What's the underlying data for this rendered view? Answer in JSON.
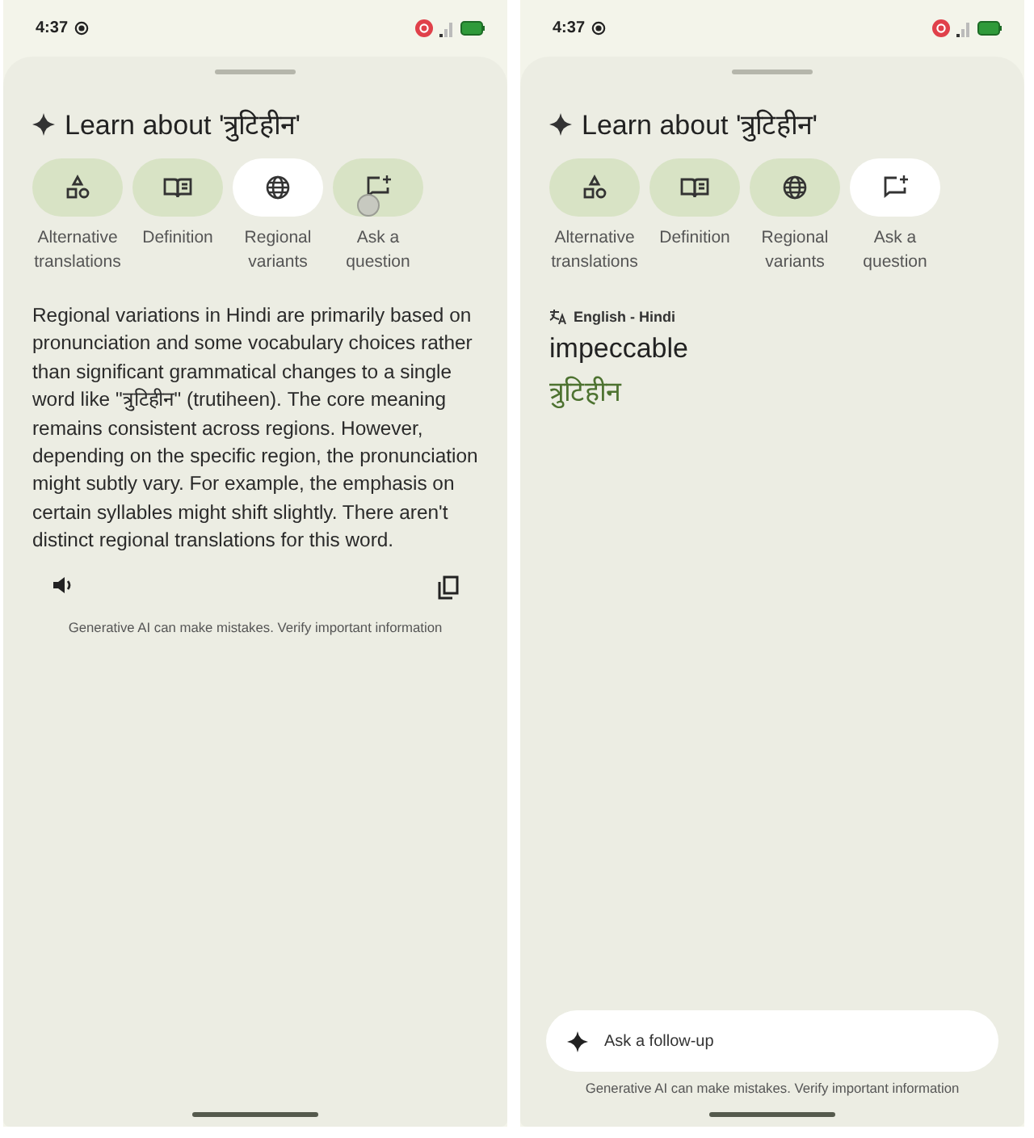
{
  "screens": [
    {
      "kind": "answer",
      "status_bar": {
        "time": "4:37"
      },
      "title": "Learn about 'त्रुटिहीन'",
      "chips": [
        {
          "label": "Alternative translations",
          "selected": false,
          "touched": false
        },
        {
          "label": "Definition",
          "selected": false,
          "touched": false
        },
        {
          "label": "Regional variants",
          "selected": true,
          "touched": false
        },
        {
          "label": "Ask a question",
          "selected": false,
          "touched": true
        }
      ],
      "answer": "Regional variations in Hindi are primarily based on pronunciation and some vocabulary choices rather than significant grammatical changes to a single word like \"त्रुटिहीन\" (trutiheen).  The core meaning remains consistent across regions.  However, depending on the specific region, the pronunciation might subtly vary.  For example, the emphasis on certain syllables might shift slightly.  There aren't distinct regional translations for this word.",
      "disclaimer": "Generative AI can make mistakes. Verify important information"
    },
    {
      "kind": "translation",
      "status_bar": {
        "time": "4:37"
      },
      "title": "Learn about 'त्रुटिहीन'",
      "chips": [
        {
          "label": "Alternative translations",
          "selected": false,
          "touched": false
        },
        {
          "label": "Definition",
          "selected": false,
          "touched": false
        },
        {
          "label": "Regional variants",
          "selected": false,
          "touched": false
        },
        {
          "label": "Ask a question",
          "selected": true,
          "touched": false
        }
      ],
      "language_pair": "English - Hindi",
      "source_word": "impeccable",
      "translated_word": "त्रुटिहीन",
      "follow_up": {
        "placeholder": "Ask a follow-up"
      },
      "disclaimer": "Generative AI can make mistakes. Verify important information"
    }
  ]
}
